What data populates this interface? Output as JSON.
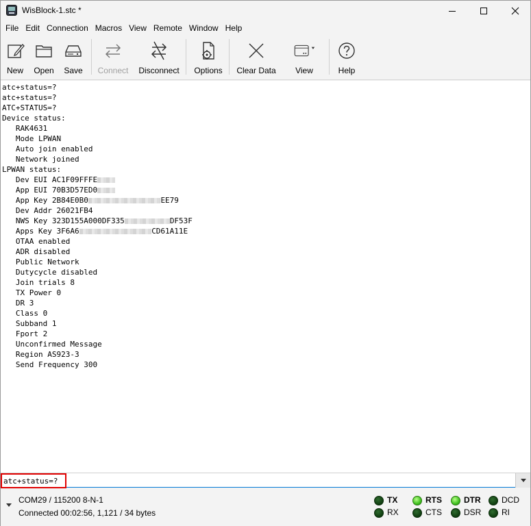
{
  "window": {
    "title": "WisBlock-1.stc *"
  },
  "menu": [
    "File",
    "Edit",
    "Connection",
    "Macros",
    "View",
    "Remote",
    "Window",
    "Help"
  ],
  "toolbar": {
    "new": "New",
    "open": "Open",
    "save": "Save",
    "connect": "Connect",
    "disconnect": "Disconnect",
    "options": "Options",
    "clear_data": "Clear Data",
    "view": "View",
    "help": "Help"
  },
  "terminal": {
    "lines": [
      {
        "text": "atc+status=?"
      },
      {
        "text": "atc+status=?"
      },
      {
        "text": "ATC+STATUS=?"
      },
      {
        "text": "Device status:"
      },
      {
        "text": "   RAK4631"
      },
      {
        "text": "   Mode LPWAN"
      },
      {
        "text": "   Auto join enabled"
      },
      {
        "text": "   Network joined"
      },
      {
        "text": "LPWAN status:"
      },
      {
        "text": "   Dev EUI AC1F09FFFE",
        "blur_chars": 4
      },
      {
        "text": "   App EUI 70B3D57ED0",
        "blur_chars": 4
      },
      {
        "text": "   App Key 2B84E0B0",
        "blur_chars": 16,
        "suffix": "EE79"
      },
      {
        "text": "   Dev Addr 26021FB4"
      },
      {
        "text": "   NWS Key 323D155A000DF335",
        "blur_chars": 10,
        "suffix": "DF53F"
      },
      {
        "text": "   Apps Key 3F6A6",
        "blur_chars": 16,
        "suffix": "CD61A11E"
      },
      {
        "text": "   OTAA enabled"
      },
      {
        "text": "   ADR disabled"
      },
      {
        "text": "   Public Network"
      },
      {
        "text": "   Dutycycle disabled"
      },
      {
        "text": "   Join trials 8"
      },
      {
        "text": "   TX Power 0"
      },
      {
        "text": "   DR 3"
      },
      {
        "text": "   Class 0"
      },
      {
        "text": "   Subband 1"
      },
      {
        "text": "   Fport 2"
      },
      {
        "text": "   Unconfirmed Message"
      },
      {
        "text": "   Region AS923-3"
      },
      {
        "text": "   Send Frequency 300"
      }
    ]
  },
  "input": {
    "value": "atc+status=?"
  },
  "status": {
    "port": "COM29 / 115200 8-N-1",
    "connection": "Connected 00:02:56, 1,121 / 34 bytes",
    "leds": [
      {
        "label": "TX",
        "on": false,
        "bold": true
      },
      {
        "label": "RX",
        "on": false,
        "bold": false
      },
      {
        "label": "RTS",
        "on": true,
        "bold": true
      },
      {
        "label": "CTS",
        "on": false,
        "bold": false
      },
      {
        "label": "DTR",
        "on": true,
        "bold": true
      },
      {
        "label": "DSR",
        "on": false,
        "bold": false
      },
      {
        "label": "DCD",
        "on": false,
        "bold": false
      },
      {
        "label": "RI",
        "on": false,
        "bold": false
      }
    ]
  }
}
